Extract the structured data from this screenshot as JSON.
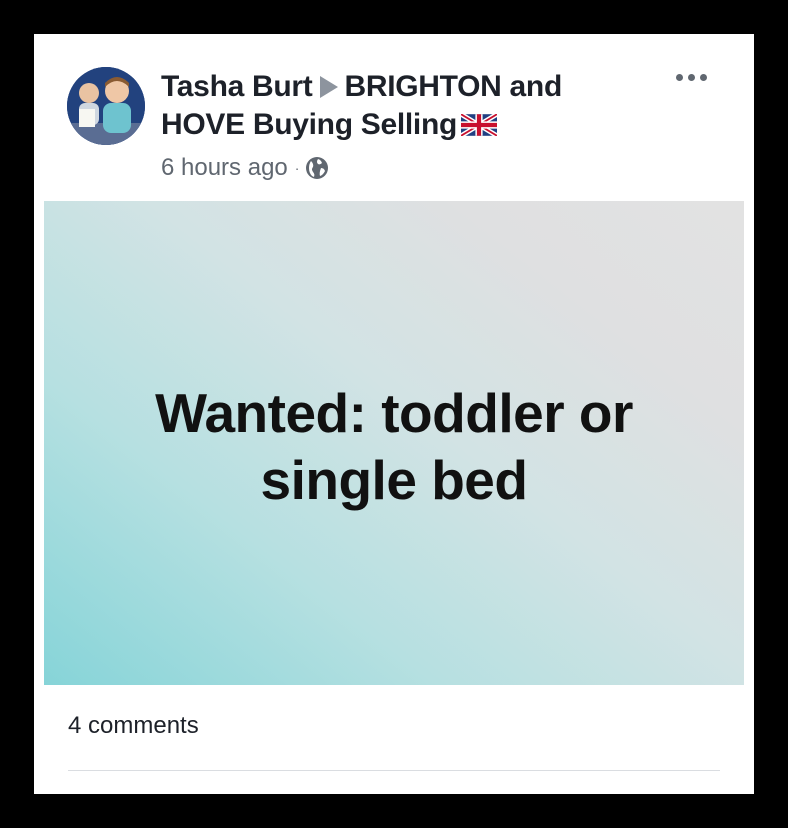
{
  "post": {
    "author": "Tasha Burt",
    "group": "BRIGHTON and HOVE Buying Selling",
    "flag_icon": "uk-flag-icon",
    "timestamp": "6 hours ago",
    "separator": "·",
    "privacy_icon": "globe-icon",
    "more_icon": "more-options-icon",
    "banner": {
      "lines": [
        "Wanted: toddler or",
        "single bed"
      ],
      "gradient_colors": [
        "#86d4d8",
        "#d2e3e4",
        "#e2e2e2"
      ]
    },
    "comments_label": "4 comments"
  },
  "colors": {
    "frame": "#000000",
    "card": "#ffffff",
    "title_text": "#1d2129",
    "meta_text": "#606770",
    "arrow": "#8d949e"
  }
}
